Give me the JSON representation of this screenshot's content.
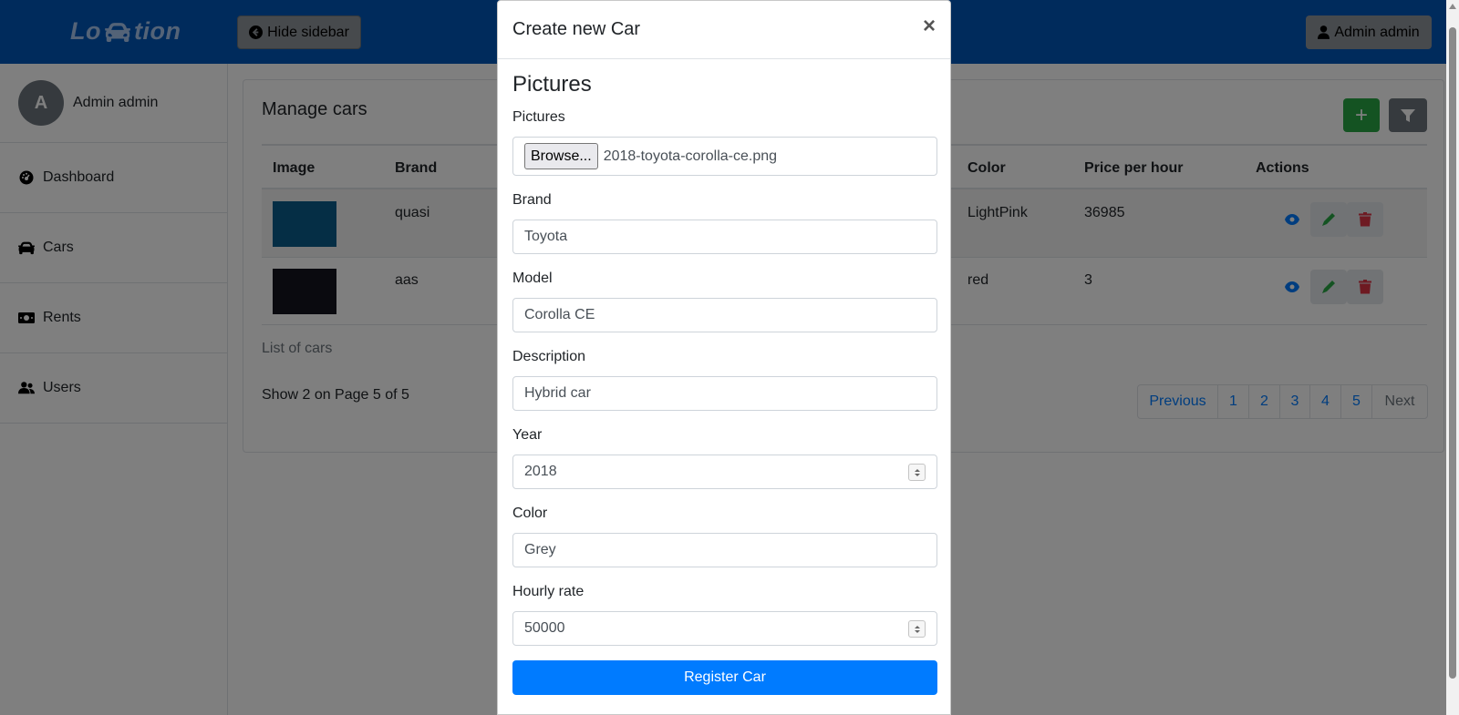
{
  "navbar": {
    "brand_left": "Lo",
    "brand_right": "tion",
    "hide_sidebar": "Hide sidebar",
    "user_button": "Admin admin"
  },
  "sidebar": {
    "avatar_letter": "A",
    "user_name": "Admin admin",
    "items": [
      {
        "label": "Dashboard",
        "icon": "dashboard-icon"
      },
      {
        "label": "Cars",
        "icon": "car-icon"
      },
      {
        "label": "Rents",
        "icon": "money-icon"
      },
      {
        "label": "Users",
        "icon": "users-icon"
      }
    ]
  },
  "main": {
    "title": "Manage cars",
    "add_button": "+",
    "columns": [
      "Image",
      "Brand",
      "Color",
      "Price per hour",
      "Actions"
    ],
    "rows": [
      {
        "brand": "quasi",
        "color": "LightPink",
        "price": "36985"
      },
      {
        "brand": "aas",
        "color": "red",
        "price": "3"
      }
    ],
    "caption": "List of cars",
    "page_info": "Show 2 on Page 5 of 5",
    "pagination": [
      "Previous",
      "1",
      "2",
      "3",
      "4",
      "5",
      "Next"
    ]
  },
  "modal": {
    "title": "Create new Car",
    "close": "×",
    "section_title": "Pictures",
    "fields": {
      "pictures_label": "Pictures",
      "browse": "Browse...",
      "file_name": "2018-toyota-corolla-ce.png",
      "brand_label": "Brand",
      "brand_value": "Toyota",
      "model_label": "Model",
      "model_value": "Corolla CE",
      "description_label": "Description",
      "description_value": "Hybrid car",
      "year_label": "Year",
      "year_value": "2018",
      "color_label": "Color",
      "color_value": "Grey",
      "rate_label": "Hourly rate",
      "rate_value": "50000"
    },
    "submit": "Register Car"
  },
  "colors": {
    "navbar": "#0057b8",
    "primary": "#007bff",
    "success": "#28a745",
    "danger": "#dc3545",
    "secondary": "#6c757d"
  }
}
